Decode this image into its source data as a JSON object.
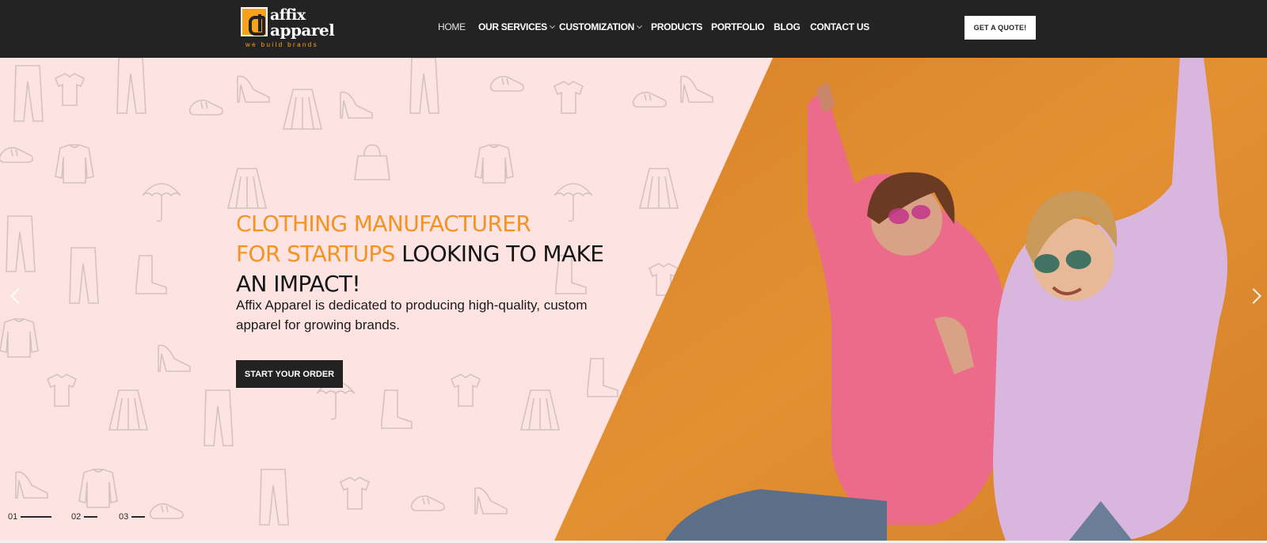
{
  "brand": {
    "logo_line1": "affix",
    "logo_line2": "apparel",
    "tagline": "we build brands",
    "accent_color": "#f7a21b"
  },
  "nav": {
    "items": [
      {
        "label": "HOME",
        "active": true,
        "dropdown": false
      },
      {
        "label": "OUR SERVICES",
        "active": false,
        "dropdown": true
      },
      {
        "label": "CUSTOMIZATION",
        "active": false,
        "dropdown": true
      },
      {
        "label": "PRODUCTS",
        "active": false,
        "dropdown": false
      },
      {
        "label": "PORTFOLIO",
        "active": false,
        "dropdown": false
      },
      {
        "label": "BLOG",
        "active": false,
        "dropdown": false
      },
      {
        "label": "CONTACT US",
        "active": false,
        "dropdown": false
      }
    ],
    "quote_button": "GET A QUOTE!"
  },
  "hero": {
    "headline_orange_1": "CLOTHING MANUFACTURER",
    "headline_orange_2": "FOR STARTUPS",
    "headline_dark_1": " LOOKING TO MAKE",
    "headline_dark_2": "AN IMPACT!",
    "subtext": "Affix Apparel is dedicated to producing high-quality, custom apparel for growing brands.",
    "cta_label": "START YOUR ORDER",
    "image_icon": "two-women-in-hoodies-photo",
    "pattern_icon": "clothing-sketch-pattern",
    "colors": {
      "left_background": "#fde4e2",
      "right_background": "#e08a2c",
      "headline_orange": "#f39322"
    }
  },
  "slider": {
    "prev_icon": "chevron-left-icon",
    "next_icon": "chevron-right-icon",
    "pages": [
      "01",
      "02",
      "03"
    ],
    "current_page": "01"
  }
}
